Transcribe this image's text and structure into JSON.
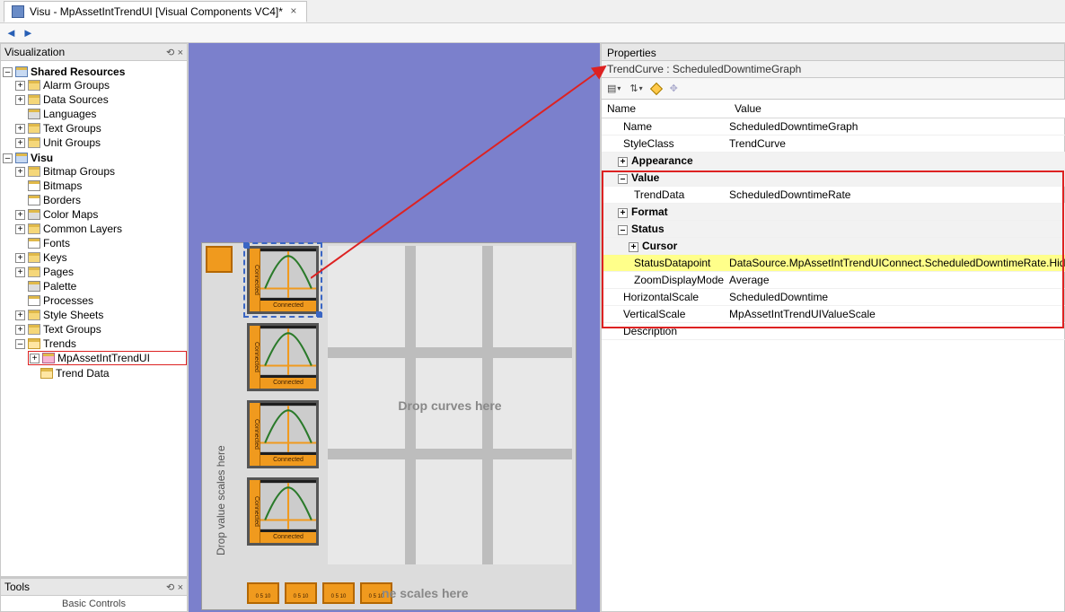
{
  "tab": {
    "title": "Visu - MpAssetIntTrendUI [Visual Components VC4]*"
  },
  "nav": {
    "back": "◄",
    "fwd": "►"
  },
  "left": {
    "viz_title": "Visualization",
    "tree": {
      "shared": "Shared Resources",
      "alarm": "Alarm Groups",
      "datasrc": "Data Sources",
      "lang": "Languages",
      "txtgrp_s": "Text Groups",
      "unitgrp": "Unit Groups",
      "visu": "Visu",
      "bmpgrp": "Bitmap Groups",
      "bmp": "Bitmaps",
      "borders": "Borders",
      "cmaps": "Color Maps",
      "clayers": "Common Layers",
      "fonts": "Fonts",
      "keys": "Keys",
      "pages": "Pages",
      "palette": "Palette",
      "proc": "Processes",
      "styles": "Style Sheets",
      "txtgrp_v": "Text Groups",
      "trends": "Trends",
      "trendui": "MpAssetIntTrendUI",
      "trenddata": "Trend Data"
    },
    "tools_title": "Tools",
    "tools_body": "Basic Controls"
  },
  "canvas": {
    "curve_side": "Connected",
    "curve_foot": "Connected",
    "grid_hint": "Drop curves here",
    "vlabel": "Drop value scales here",
    "hlabel": "ne scales here",
    "hsc": "0 5 10"
  },
  "props": {
    "title": "Properties",
    "subtitle": "TrendCurve : ScheduledDowntimeGraph",
    "col_name": "Name",
    "col_value": "Value",
    "rows": {
      "name_k": "Name",
      "name_v": "ScheduledDowntimeGraph",
      "style_k": "StyleClass",
      "style_v": "TrendCurve",
      "appearance": "Appearance",
      "value": "Value",
      "trenddata_k": "TrendData",
      "trenddata_v": "ScheduledDowntimeRate",
      "format": "Format",
      "status": "Status",
      "cursor": "Cursor",
      "sdp_k": "StatusDatapoint",
      "sdp_v": "DataSource.MpAssetIntTrendUIConnect.ScheduledDowntimeRate.HideCurve",
      "zoom_k": "ZoomDisplayMode",
      "zoom_v": "Average",
      "hscale_k": "HorizontalScale",
      "hscale_v": "ScheduledDowntime",
      "vscale_k": "VerticalScale",
      "vscale_v": "MpAssetIntTrendUIValueScale",
      "desc_k": "Description",
      "desc_v": ""
    }
  }
}
